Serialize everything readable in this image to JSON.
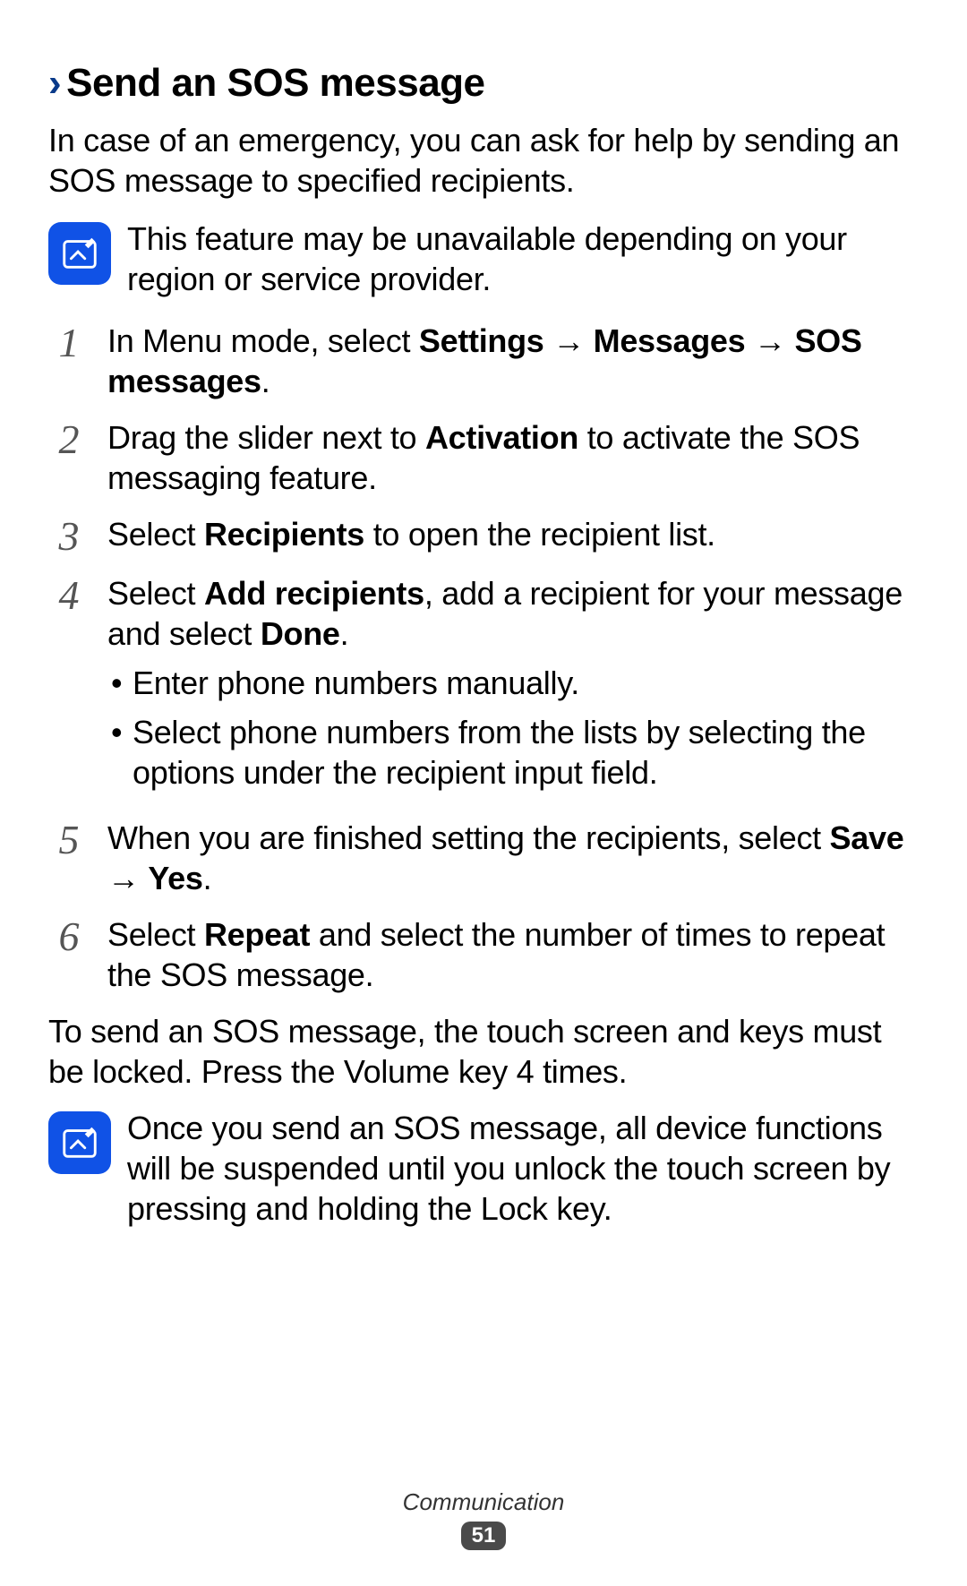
{
  "heading": "Send an SOS message",
  "intro": "In case of an emergency, you can ask for help by sending an SOS message to specified recipients.",
  "note1": "This feature may be unavailable depending on your region or service provider.",
  "steps": {
    "s1": {
      "num": "1",
      "pre": "In Menu mode, select ",
      "b1": "Settings",
      "arr1": " → ",
      "b2": "Messages",
      "arr2": " → ",
      "b3": "SOS messages",
      "post": "."
    },
    "s2": {
      "num": "2",
      "pre": "Drag the slider next to ",
      "b1": "Activation",
      "post": " to activate the SOS messaging feature."
    },
    "s3": {
      "num": "3",
      "pre": "Select ",
      "b1": "Recipients",
      "post": " to open the recipient list."
    },
    "s4": {
      "num": "4",
      "pre": "Select ",
      "b1": "Add recipients",
      "mid": ", add a recipient for your message and select ",
      "b2": "Done",
      "post": ".",
      "bullets": [
        "Enter phone numbers manually.",
        "Select phone numbers from the lists by selecting the options under the recipient input field."
      ]
    },
    "s5": {
      "num": "5",
      "pre": "When you are finished setting the recipients, select ",
      "b1": "Save",
      "arr": " → ",
      "b2": "Yes",
      "post": "."
    },
    "s6": {
      "num": "6",
      "pre": "Select ",
      "b1": "Repeat",
      "post": " and select the number of times to repeat the SOS message."
    }
  },
  "para2": "To send an SOS message, the touch screen and keys must be locked. Press the Volume key 4 times.",
  "note2": "Once you send an SOS message, all device functions will be suspended until you unlock the touch screen by pressing and holding the Lock key.",
  "footer": {
    "section": "Communication",
    "page": "51"
  }
}
